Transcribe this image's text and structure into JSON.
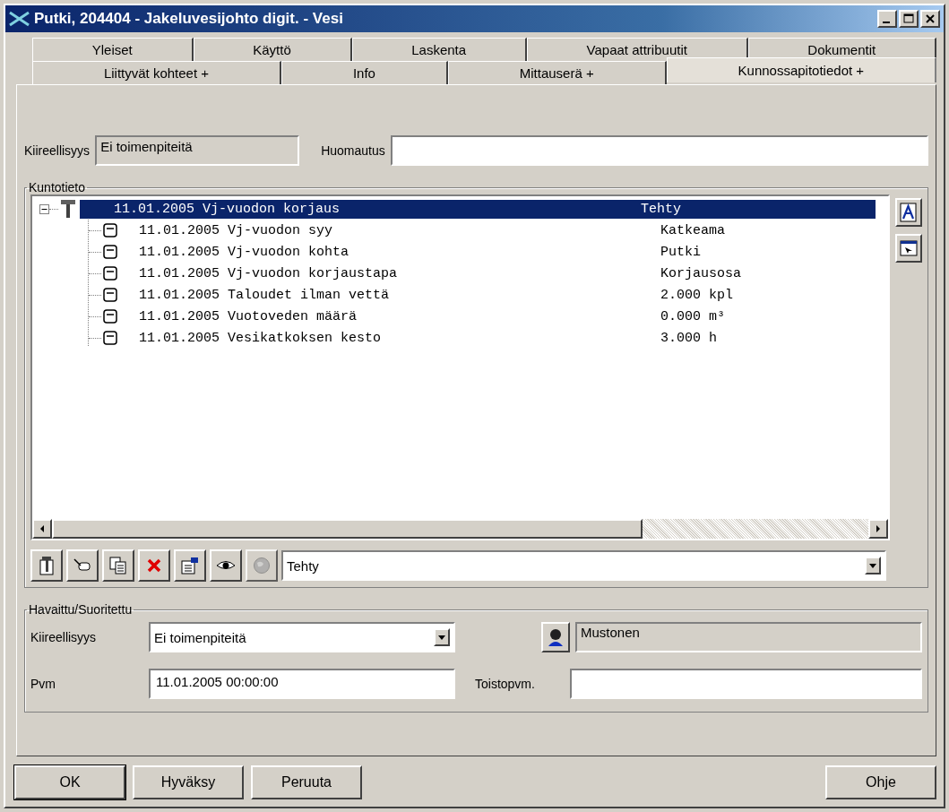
{
  "window": {
    "title": "Putki, 204404 - Jakeluvesijohto digit. - Vesi"
  },
  "tab_rows": [
    {
      "tabs": [
        {
          "label": "Yleiset",
          "selected": false
        },
        {
          "label": "Käyttö",
          "selected": false
        },
        {
          "label": "Laskenta",
          "selected": false
        },
        {
          "label": "Vapaat attribuutit",
          "selected": false
        },
        {
          "label": "Dokumentit",
          "selected": false
        }
      ]
    },
    {
      "tabs": [
        {
          "label": "Liittyvät kohteet +",
          "selected": false
        },
        {
          "label": "Info",
          "selected": false
        },
        {
          "label": "Mittauserä +",
          "selected": false
        },
        {
          "label": "Kunnossapitotiedot +",
          "selected": true
        }
      ]
    }
  ],
  "urgency": {
    "label": "Kiireellisyys",
    "value": "Ei toimenpiteitä"
  },
  "note": {
    "label": "Huomautus"
  },
  "condition": {
    "title": "Kuntotieto",
    "tree": [
      {
        "date": "11.01.2005",
        "name": "Vj-vuodon korjaus",
        "value": "Tehty",
        "selected": true,
        "expanded": true,
        "children": [
          {
            "date": "11.01.2005",
            "name": "Vj-vuodon syy",
            "value": "Katkeama",
            "selected": false
          },
          {
            "date": "11.01.2005",
            "name": "Vj-vuodon kohta",
            "value": "Putki",
            "selected": false
          },
          {
            "date": "11.01.2005",
            "name": "Vj-vuodon korjaustapa",
            "value": "Korjausosa",
            "selected": false
          },
          {
            "date": "11.01.2005",
            "name": "Taloudet ilman vettä",
            "value": "2.000 kpl",
            "selected": false
          },
          {
            "date": "11.01.2005",
            "name": "Vuotoveden määrä",
            "value": "0.000 m³",
            "selected": false
          },
          {
            "date": "11.01.2005",
            "name": "Vesikatkoksen kesto",
            "value": "3.000 h",
            "selected": false
          }
        ]
      }
    ],
    "status_select": {
      "value": "Tehty"
    }
  },
  "observed": {
    "title": "Havaittu/Suoritettu",
    "urgency": {
      "label": "Kiireellisyys",
      "value": "Ei toimenpiteitä"
    },
    "person": {
      "value": "Mustonen"
    },
    "date": {
      "label": "Pvm",
      "value": "11.01.2005 00:00:00"
    },
    "repeat_date": {
      "label": "Toistopvm."
    }
  },
  "buttons": [
    {
      "label": "OK",
      "default": true
    },
    {
      "label": "Hyväksy",
      "default": false
    },
    {
      "label": "Peruuta",
      "default": false
    },
    {
      "label": "Ohje",
      "default": false
    }
  ]
}
